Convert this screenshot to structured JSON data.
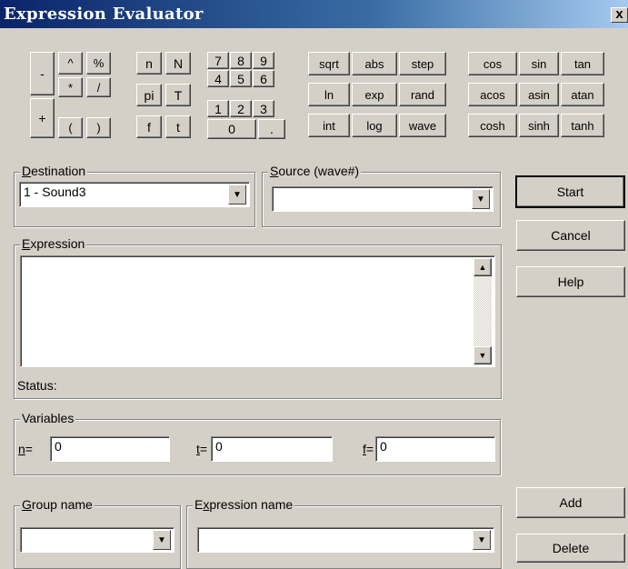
{
  "window": {
    "title": "Expression Evaluator",
    "close_glyph": "x"
  },
  "keypad": {
    "operators": [
      "-",
      "^",
      "%",
      "*",
      "/",
      "+",
      "(",
      ")"
    ],
    "constants": [
      "n",
      "N",
      "pi",
      "T",
      "f",
      "t"
    ],
    "digits": [
      "7",
      "8",
      "9",
      "4",
      "5",
      "6",
      "1",
      "2",
      "3",
      "0",
      "."
    ],
    "functions1": [
      "sqrt",
      "abs",
      "step",
      "ln",
      "exp",
      "rand",
      "int",
      "log",
      "wave"
    ],
    "functions2": [
      "cos",
      "sin",
      "tan",
      "acos",
      "asin",
      "atan",
      "cosh",
      "sinh",
      "tanh"
    ]
  },
  "destination": {
    "label_key": "D",
    "label_rest": "estination",
    "value": "1 - Sound3"
  },
  "source": {
    "label_key": "S",
    "label_rest": "ource (wave#)",
    "value": ""
  },
  "expression": {
    "label_key": "E",
    "label_rest": "xpression",
    "value": "",
    "status_label": "Status:"
  },
  "variables": {
    "label": "Variables",
    "n": {
      "key": "n",
      "label_rest": "=",
      "value": "0"
    },
    "t": {
      "key": "t",
      "label_rest": "=",
      "value": "0"
    },
    "f": {
      "key": "f",
      "label_rest": "=",
      "value": "0"
    }
  },
  "group": {
    "label_key": "G",
    "label_rest": "roup name",
    "value": ""
  },
  "expression_name": {
    "label_pre": "E",
    "label_key": "x",
    "label_rest": "pression name",
    "value": ""
  },
  "buttons": {
    "start": "Start",
    "cancel": "Cancel",
    "help": "Help",
    "add": "Add",
    "delete": "Delete"
  }
}
